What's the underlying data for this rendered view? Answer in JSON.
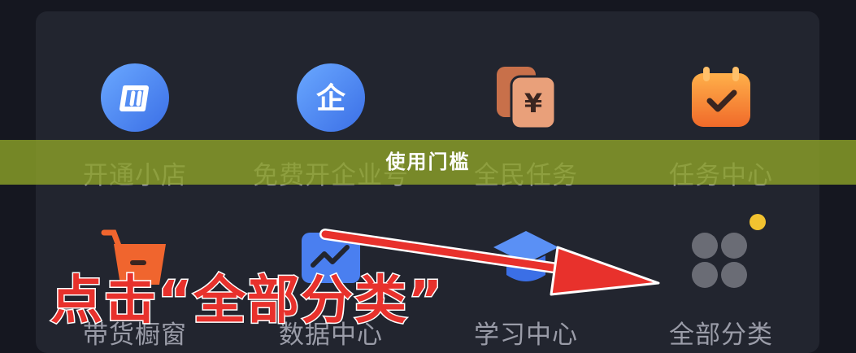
{
  "menu": {
    "row1": [
      {
        "label": "开通小店",
        "icon": "shop-open-icon",
        "color": "#4a7ff0"
      },
      {
        "label": "免费开企业号",
        "icon": "enterprise-icon",
        "color": "#4a7ff0"
      },
      {
        "label": "全民任务",
        "icon": "money-cards-icon",
        "color": "#d9805a"
      },
      {
        "label": "任务中心",
        "icon": "calendar-check-icon",
        "color": "#f07a2e"
      }
    ],
    "row2": [
      {
        "label": "带货橱窗",
        "icon": "shopping-cart-icon",
        "color": "#f0652e"
      },
      {
        "label": "数据中心",
        "icon": "data-chart-icon",
        "color": "#4a7ff0"
      },
      {
        "label": "学习中心",
        "icon": "graduation-cap-icon",
        "color": "#4a7ff0"
      },
      {
        "label": "全部分类",
        "icon": "all-categories-icon",
        "color": "#6a6c75"
      }
    ]
  },
  "banner": {
    "text": "使用门槛"
  },
  "overlay": {
    "instruction": "点击“全部分类”"
  },
  "colors": {
    "annotation_red": "#e8312c",
    "banner_green": "#8ba028",
    "notification_dot": "#f2c230"
  }
}
